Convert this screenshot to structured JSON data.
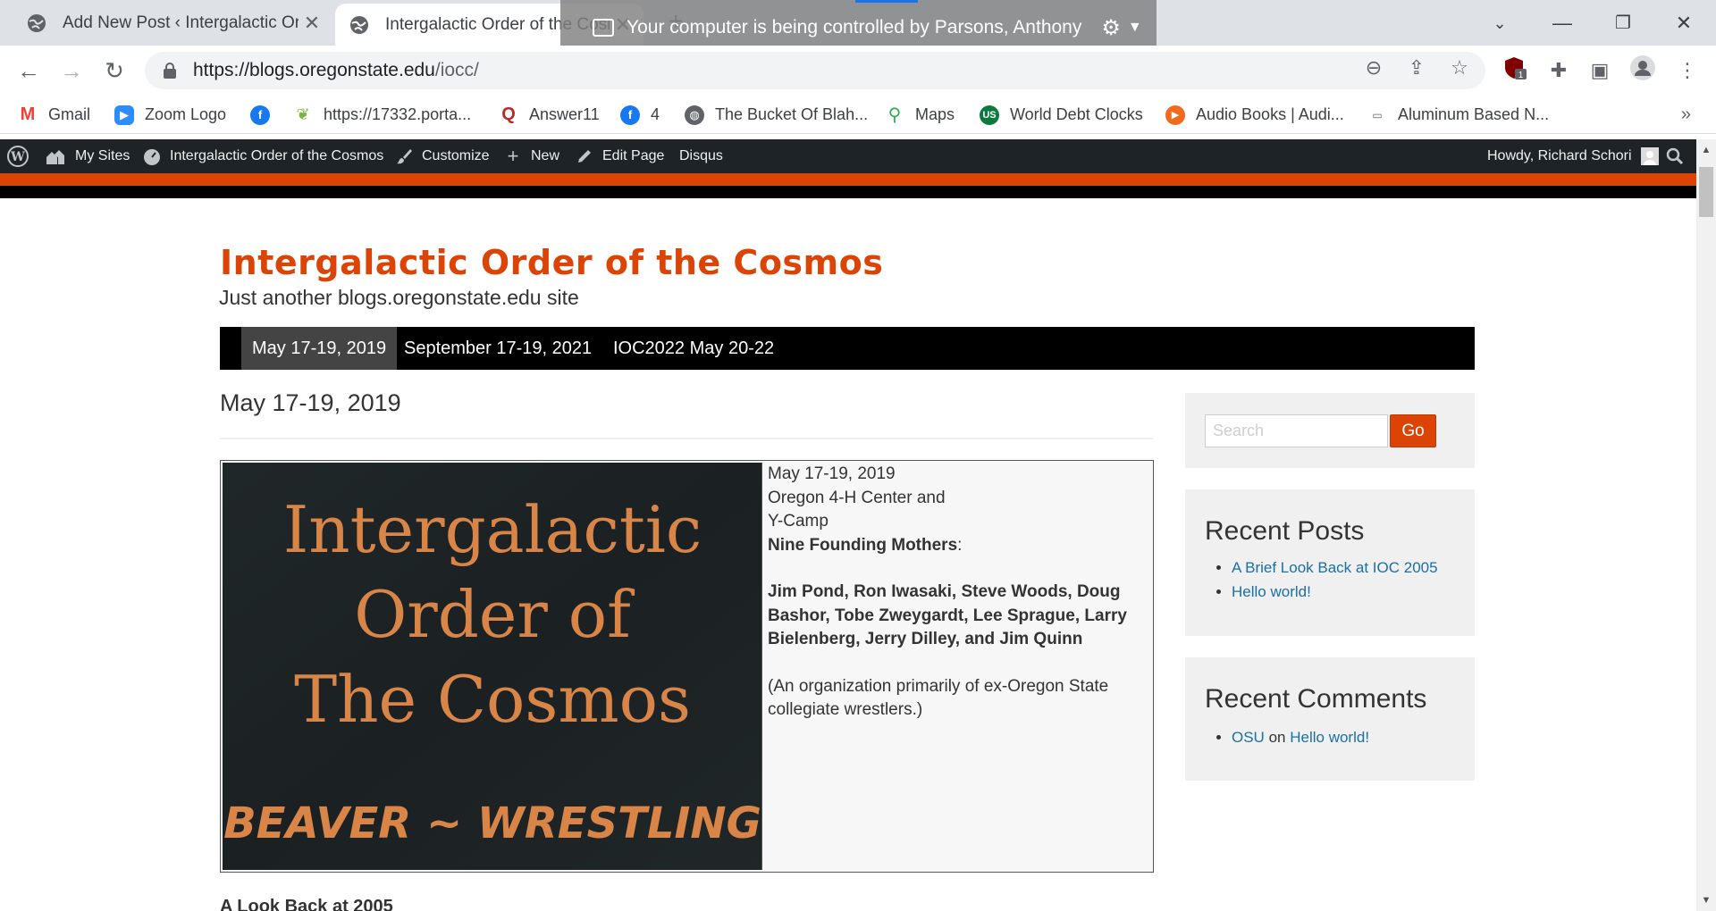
{
  "browser": {
    "tabs": [
      {
        "title": "Add New Post ‹ Intergalactic Order of the Cosmos",
        "active": false
      },
      {
        "title": "Intergalactic Order of the Cosmos",
        "active": true
      }
    ],
    "screen_share_notice": "Your computer is being controlled by Parsons, Anthony",
    "url_host": "https://blogs.oregonstate.edu",
    "url_path": "/iocc/",
    "bookmarks": [
      {
        "label": "Gmail",
        "icon": "gmail-icon"
      },
      {
        "label": "Zoom Logo",
        "icon": "zoom-icon"
      },
      {
        "label": "",
        "icon": "facebook-icon"
      },
      {
        "label": "https://17332.porta...",
        "icon": "leaf-icon"
      },
      {
        "label": "Answer11",
        "icon": "quora-icon"
      },
      {
        "label": "4",
        "icon": "facebook-icon"
      },
      {
        "label": "The Bucket Of Blah...",
        "icon": "globe-icon"
      },
      {
        "label": "Maps",
        "icon": "maps-pin-icon"
      },
      {
        "label": "World Debt Clocks",
        "icon": "us-debt-icon"
      },
      {
        "label": "Audio Books | Audi...",
        "icon": "play-icon"
      },
      {
        "label": "Aluminum Based N...",
        "icon": "aluminum-icon"
      }
    ],
    "extension_badge": "1"
  },
  "adminbar": {
    "my_sites": "My Sites",
    "site_name": "Intergalactic Order of the Cosmos",
    "customize": "Customize",
    "new": "New",
    "edit_page": "Edit Page",
    "disqus": "Disqus",
    "howdy": "Howdy, Richard Schori"
  },
  "site": {
    "title": "Intergalactic Order of the Cosmos",
    "description": "Just another blogs.oregonstate.edu site",
    "nav": [
      {
        "label": "May 17-19, 2019",
        "current": true
      },
      {
        "label": "September 17-19, 2021",
        "current": false
      },
      {
        "label": "IOC2022 May 20-22",
        "current": false
      }
    ]
  },
  "post": {
    "title": "May 17-19, 2019",
    "image_text": {
      "line1": "Intergalactic",
      "line2": "Order of",
      "line3": "The Cosmos",
      "line4": "BEAVER ~ WRESTLING"
    },
    "date": "May 17-19, 2019",
    "location_1": "Oregon 4-H Center and",
    "location_2": "Y-Camp",
    "founders_heading": "Nine Founding Mothers",
    "founders_colon": ":",
    "founders": "Jim Pond, Ron Iwasaki, Steve Woods, Doug Bashor, Tobe Zweygardt, Lee Sprague, Larry Bielenberg, Jerry Dilley, and Jim Quinn",
    "note": "(An organization primarily of ex-Oregon State collegiate wrestlers.)",
    "next_heading": "A Look Back at 2005"
  },
  "sidebar": {
    "search_placeholder": "Search",
    "search_button": "Go",
    "recent_posts_title": "Recent Posts",
    "recent_posts": [
      "A Brief Look Back at IOC 2005",
      "Hello world!"
    ],
    "recent_comments_title": "Recent Comments",
    "recent_comment_author": "OSU",
    "recent_comment_on": "on",
    "recent_comment_post": "Hello world!"
  },
  "colors": {
    "osu_orange": "#dc4405",
    "admin_bar": "#1d2327",
    "link_blue": "#1a6fa6"
  }
}
